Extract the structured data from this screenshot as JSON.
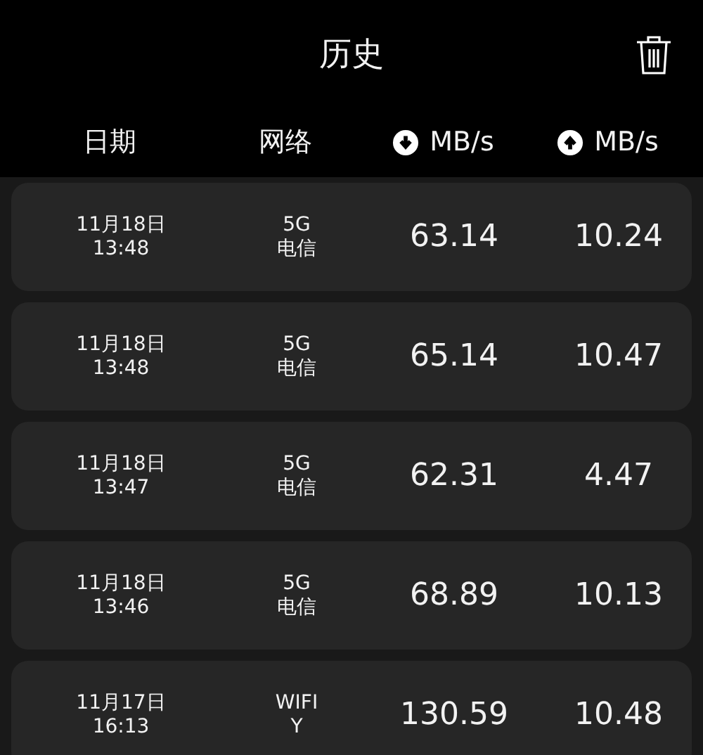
{
  "header": {
    "title": "历史"
  },
  "columns": [
    {
      "label": "日期",
      "kind": "text"
    },
    {
      "label": "网络",
      "kind": "text"
    },
    {
      "label": "MB/s",
      "kind": "download"
    },
    {
      "label": "MB/s",
      "kind": "upload"
    }
  ],
  "rows": [
    {
      "date": "11月18日",
      "time": "13:48",
      "network": "5G",
      "carrier": "电信",
      "download": "63.14",
      "upload": "10.24"
    },
    {
      "date": "11月18日",
      "time": "13:48",
      "network": "5G",
      "carrier": "电信",
      "download": "65.14",
      "upload": "10.47"
    },
    {
      "date": "11月18日",
      "time": "13:47",
      "network": "5G",
      "carrier": "电信",
      "download": "62.31",
      "upload": "4.47"
    },
    {
      "date": "11月18日",
      "time": "13:46",
      "network": "5G",
      "carrier": "电信",
      "download": "68.89",
      "upload": "10.13"
    },
    {
      "date": "11月17日",
      "time": "16:13",
      "network": "WIFI",
      "carrier": "Y",
      "download": "130.59",
      "upload": "10.48"
    }
  ]
}
